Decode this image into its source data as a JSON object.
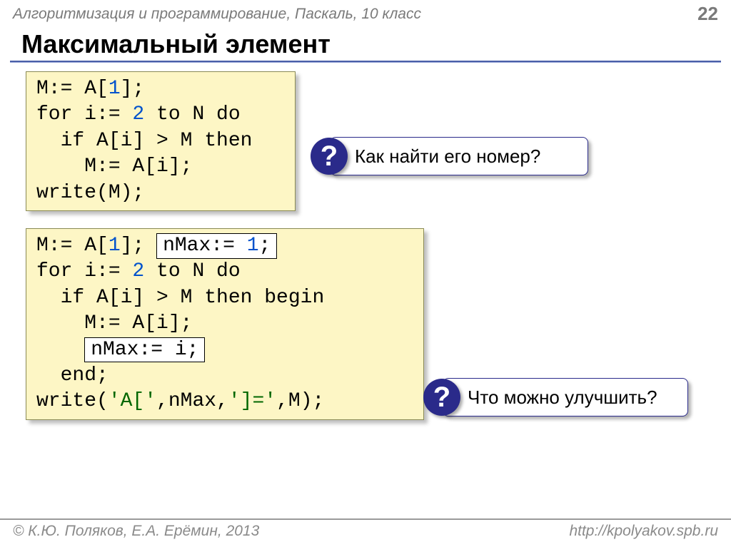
{
  "header": {
    "course": "Алгоритмизация и программирование, Паскаль, 10 класс",
    "page": "22"
  },
  "title": "Максимальный элемент",
  "code1": {
    "l1a": "M:= A[",
    "l1n": "1",
    "l1b": "];",
    "l2a": "for i:= ",
    "l2n": "2",
    "l2b": " to N do",
    "l3": "  if A[i] > M then",
    "l4": "    M:= A[i];",
    "l5": "write(M);"
  },
  "callout1": "Как найти его номер?",
  "code2": {
    "l1a": "M:= A[",
    "l1n": "1",
    "l1b": "]; ",
    "ins1a": "nMax:= ",
    "ins1n": "1",
    "ins1b": ";",
    "l2a": "for i:= ",
    "l2n": "2",
    "l2b": " to N do",
    "l3": "  if A[i] > M then begin",
    "l4": "    M:= A[i];",
    "ins2pre": "    ",
    "ins2": "nMax:= i;",
    "l6": "  end;",
    "l7a": "write(",
    "l7s1": "'A['",
    "l7b": ",nMax,",
    "l7s2": "']='",
    "l7c": ",M);"
  },
  "callout2": "Что можно улучшить?",
  "footer": {
    "copyright": "© К.Ю. Поляков, Е.А. Ерёмин, 2013",
    "url": "http://kpolyakov.spb.ru"
  }
}
